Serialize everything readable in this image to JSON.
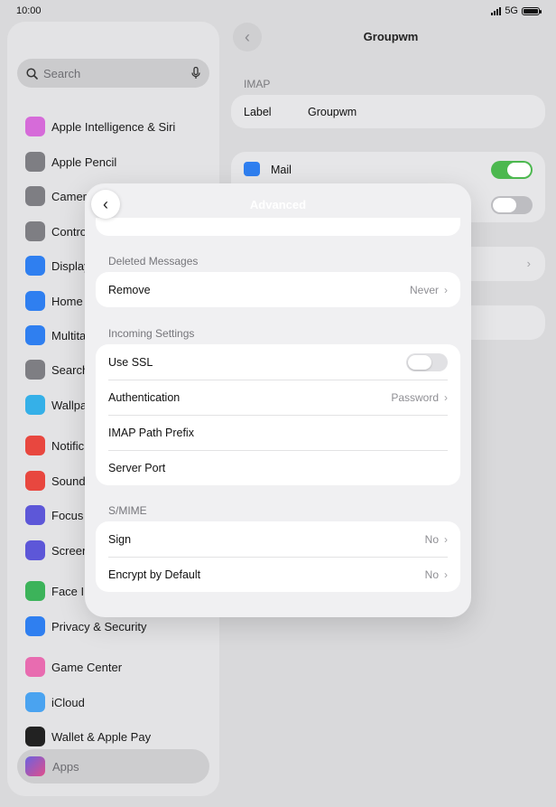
{
  "status_bar": {
    "time": "10:00",
    "network": "5G"
  },
  "sidebar": {
    "search_placeholder": "Search",
    "items": [
      {
        "label": "Apple Intelligence & Siri",
        "icon": "siri-icon",
        "color": "#d66bd9"
      },
      {
        "label": "Apple Pencil",
        "icon": "pencil-icon",
        "color": "#7e7e83"
      },
      {
        "label": "Camera",
        "icon": "camera-icon",
        "color": "#7e7e83"
      },
      {
        "label": "Contro",
        "icon": "control-centre-icon",
        "color": "#7e7e83"
      },
      {
        "label": "Display",
        "icon": "brightness-icon",
        "color": "#2f7ff0"
      },
      {
        "label": "Home",
        "icon": "home-screen-icon",
        "color": "#2f7ff0"
      },
      {
        "label": "Multita",
        "icon": "multitasking-icon",
        "color": "#2f7ff0"
      },
      {
        "label": "Search",
        "icon": "search-icon",
        "color": "#7e7e83"
      },
      {
        "label": "Wallpa",
        "icon": "wallpaper-icon",
        "color": "#35b0e8"
      },
      {
        "label": "Notific",
        "icon": "bell-icon",
        "color": "#e8473f"
      },
      {
        "label": "Sounds",
        "icon": "speaker-icon",
        "color": "#e8473f"
      },
      {
        "label": "Focus",
        "icon": "moon-icon",
        "color": "#5d57d8"
      },
      {
        "label": "Screen",
        "icon": "hourglass-icon",
        "color": "#5d57d8"
      },
      {
        "label": "Face ID",
        "icon": "face-id-icon",
        "color": "#3cb35a"
      },
      {
        "label": "Privacy & Security",
        "icon": "hand-icon",
        "color": "#2f7ff0"
      },
      {
        "label": "Game Center",
        "icon": "game-center-icon",
        "color": "#e86cb0"
      },
      {
        "label": "iCloud",
        "icon": "cloud-icon",
        "color": "#4aa3f0"
      },
      {
        "label": "Wallet & Apple Pay",
        "icon": "wallet-icon",
        "color": "#222222"
      }
    ],
    "apps_label": "Apps"
  },
  "main": {
    "title": "Groupwm",
    "section_imap": "IMAP",
    "label_key": "Label",
    "label_value": "Groupwm",
    "mail_label": "Mail"
  },
  "modal": {
    "title": "Advanced",
    "deleted_header": "Deleted Messages",
    "remove_label": "Remove",
    "remove_value": "Never",
    "incoming_header": "Incoming Settings",
    "use_ssl_label": "Use SSL",
    "use_ssl_on": false,
    "auth_label": "Authentication",
    "auth_value": "Password",
    "imap_prefix_label": "IMAP Path Prefix",
    "server_port_label": "Server Port",
    "smime_header": "S/MIME",
    "sign_label": "Sign",
    "sign_value": "No",
    "encrypt_label": "Encrypt by Default",
    "encrypt_value": "No"
  }
}
